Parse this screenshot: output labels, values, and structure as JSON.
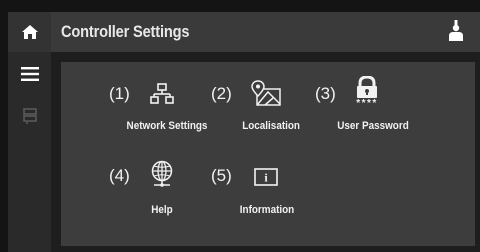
{
  "header": {
    "title": "Controller Settings"
  },
  "sidebar": {
    "items": [
      {
        "icon": "home-icon"
      },
      {
        "icon": "menu-icon"
      },
      {
        "icon": "devices-icon"
      }
    ]
  },
  "settings": [
    {
      "number": "(1)",
      "label": "Network Settings",
      "icon": "network-icon"
    },
    {
      "number": "(2)",
      "label": "Localisation",
      "icon": "map-icon"
    },
    {
      "number": "(3)",
      "label": "User Password",
      "icon": "lock-icon",
      "icon_text": "****"
    },
    {
      "number": "(4)",
      "label": "Help",
      "icon": "globe-icon"
    },
    {
      "number": "(5)",
      "label": "Information",
      "icon": "info-icon",
      "icon_text": "i"
    }
  ],
  "colors": {
    "background": "#141414",
    "sidebar": "#2a2a2a",
    "header": "#3a3a3a",
    "panel": "#3d3d3d",
    "text": "#f2f2f2"
  }
}
